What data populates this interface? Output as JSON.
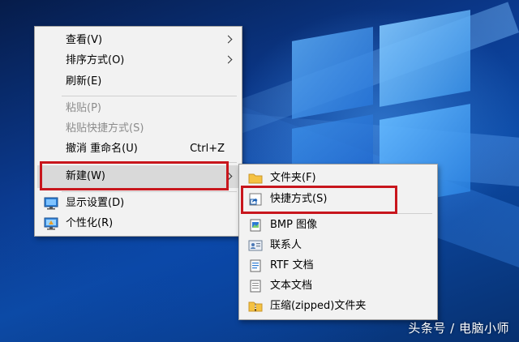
{
  "main_menu": {
    "items": [
      {
        "label": "查看(V)"
      },
      {
        "label": "排序方式(O)"
      },
      {
        "label": "刷新(E)"
      },
      {
        "label": "粘贴(P)"
      },
      {
        "label": "粘贴快捷方式(S)"
      },
      {
        "label": "撤消 重命名(U)",
        "shortcut": "Ctrl+Z"
      },
      {
        "label": "新建(W)"
      },
      {
        "label": "显示设置(D)"
      },
      {
        "label": "个性化(R)"
      }
    ]
  },
  "sub_menu": {
    "items": [
      {
        "label": "文件夹(F)"
      },
      {
        "label": "快捷方式(S)"
      },
      {
        "label": "BMP 图像"
      },
      {
        "label": "联系人"
      },
      {
        "label": "RTF 文档"
      },
      {
        "label": "文本文档"
      },
      {
        "label": "压缩(zipped)文件夹"
      }
    ]
  },
  "watermark": "头条号 / 电脑小师",
  "colors": {
    "highlight_box": "#c8161d",
    "menu_bg": "#f2f2f2"
  }
}
